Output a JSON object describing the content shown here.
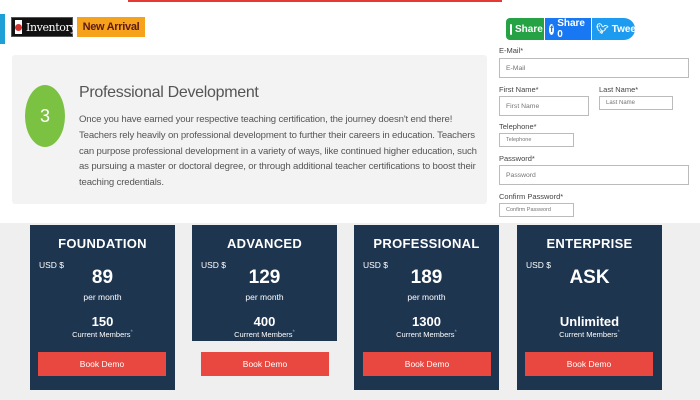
{
  "tags": {
    "inventory": "Inventory",
    "new_arrival": "New Arrival"
  },
  "share": {
    "whatsapp": "Share",
    "facebook": "Share 0",
    "twitter": "Tweet"
  },
  "step": {
    "number": "3",
    "title": "Professional Development",
    "body": "Once you have earned your respective teaching certification, the journey doesn't end there! Teachers rely heavily on professional development to further their careers in education. Teachers can purpose professional development in a variety of ways, like continued higher education, such as pursuing a master or doctoral degree, or through additional teacher certifications to boost their teaching credentials.",
    "circle_color": "#7cc242"
  },
  "form": {
    "email": {
      "label": "E-Mail*",
      "placeholder": "E-Mail"
    },
    "first_name": {
      "label": "First Name*",
      "placeholder": "First Name"
    },
    "last_name": {
      "label": "Last Name*",
      "placeholder": "Last Name"
    },
    "telephone": {
      "label": "Telephone*",
      "placeholder": "Telephone"
    },
    "password": {
      "label": "Password*",
      "placeholder": "Password"
    },
    "confirm_password": {
      "label": "Confirm Password*",
      "placeholder": "Confirm Password"
    }
  },
  "pricing": {
    "card_color": "#1e3550",
    "button_color": "#e8483f",
    "plans": [
      {
        "name": "FOUNDATION",
        "currency": "USD $",
        "price": "89",
        "period": "per month",
        "members": "150",
        "members_label": "Current Members",
        "button": "Book Demo"
      },
      {
        "name": "ADVANCED",
        "currency": "USD $",
        "price": "129",
        "period": "per month",
        "members": "400",
        "members_label": "Current Members",
        "button": "Book Demo"
      },
      {
        "name": "PROFESSIONAL",
        "currency": "USD $",
        "price": "189",
        "period": "per month",
        "members": "1300",
        "members_label": "Current Members",
        "button": "Book Demo"
      },
      {
        "name": "ENTERPRISE",
        "currency": "USD $",
        "price": "ASK",
        "period": "",
        "members": "Unlimited",
        "members_label": "Current Members",
        "button": "Book Demo"
      }
    ]
  }
}
